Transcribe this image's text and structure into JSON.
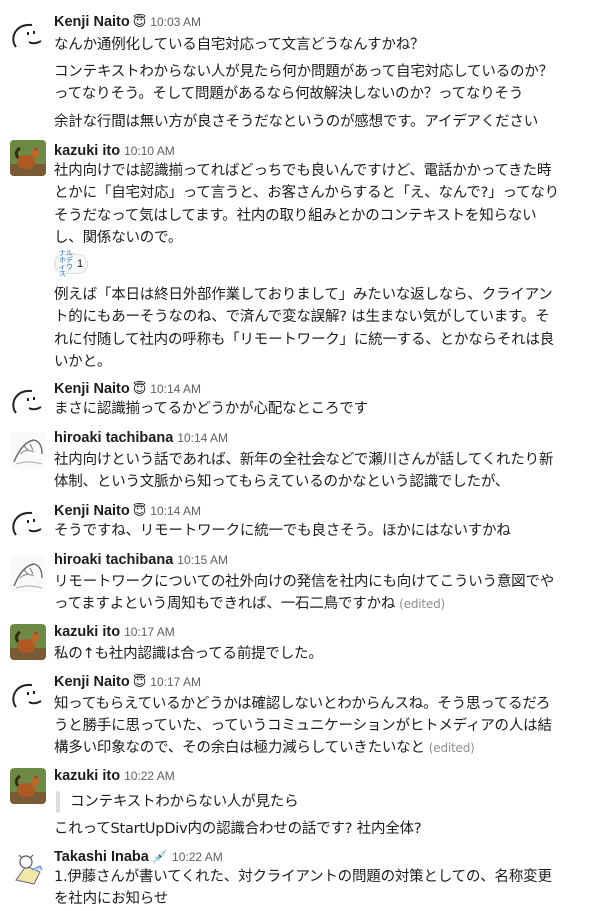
{
  "messages": [
    {
      "name": "Kenji Naito",
      "emoji": "😇",
      "time": "10:03 AM",
      "lines": [
        "なんか通例化している自宅対応って文言どうなんすかね？",
        "コンテキストわからない人が見たら何か問題があって自宅対応しているのか？",
        "ってなりそう。そして問題があるなら何故解決しないのか？ってなりそう",
        "余計な行間は無い方が良さそうだなというのが感想です。アイデアください"
      ]
    },
    {
      "name": "kazuki ito",
      "time": "10:10 AM",
      "lines": [
        "社内向けでは認識揃ってればどっちでも良いんですけど、電話かかってきた時",
        "とかに「自宅対応」って言うと、お客さんからすると「え、なんで?」ってなり",
        "そうだなって気はしてます。社内の取り組みとかのコンテキストを知らない",
        "し、関係ないので。"
      ],
      "reaction": {
        "tag": "ナルホディウス",
        "count": "1"
      },
      "lines2": [
        "例えば「本日は終日外部作業しておりまして」みたいな返しなら、クライアン",
        "ト的にもあーそうなのね、で済んで変な誤解? は生まない気がしています。そ",
        "れに付随して社内の呼称も「リモートワーク」に統一する、とかならそれは良",
        "いかと。"
      ]
    },
    {
      "name": "Kenji Naito",
      "emoji": "😇",
      "time": "10:14 AM",
      "lines": [
        "まさに認識揃ってるかどうかが心配なところです"
      ]
    },
    {
      "name": "hiroaki tachibana",
      "time": "10:14 AM",
      "lines": [
        "社内向けという話であれば、新年の全社会などで瀬川さんが話してくれたり新",
        "体制、という文脈から知ってもらえているのかなという認識でしたが、"
      ]
    },
    {
      "name": "Kenji Naito",
      "emoji": "😇",
      "time": "10:14 AM",
      "lines": [
        "そうですね、リモートワークに統一でも良さそう。ほかにはないすかね"
      ]
    },
    {
      "name": "hiroaki tachibana",
      "time": "10:15 AM",
      "lines": [
        "リモートワークについての社外向けの発信を社内にも向けてこういう意図でや",
        "ってますよという周知もできれば、一石二鳥ですかね"
      ],
      "edited": "(edited)"
    },
    {
      "name": "kazuki ito",
      "time": "10:17 AM",
      "lines": [
        "私の↑も社内認識は合ってる前提でした。"
      ]
    },
    {
      "name": "Kenji Naito",
      "emoji": "😇",
      "time": "10:17 AM",
      "lines": [
        "知ってもらえているかどうかは確認しないとわからんスね。そう思ってるだろ",
        "うと勝手に思っていた、っていうコミュニケーションがヒトメディアの人は結",
        "構多い印象なので、その余白は極力減らしていきたいなと"
      ],
      "edited": "(edited)"
    },
    {
      "name": "kazuki ito",
      "time": "10:22 AM",
      "quote": "コンテキストわからない人が見たら",
      "lines": [
        "これってStartUpDiv内の認識合わせの話です? 社内全体?"
      ]
    },
    {
      "name": "Takashi Inaba",
      "emoji": "💉",
      "time": "10:22 AM",
      "lines": [
        "1.伊藤さんが書いてくれた、対クライアントの問題の対策としての、名称変更",
        "を社内にお知らせ"
      ]
    }
  ]
}
